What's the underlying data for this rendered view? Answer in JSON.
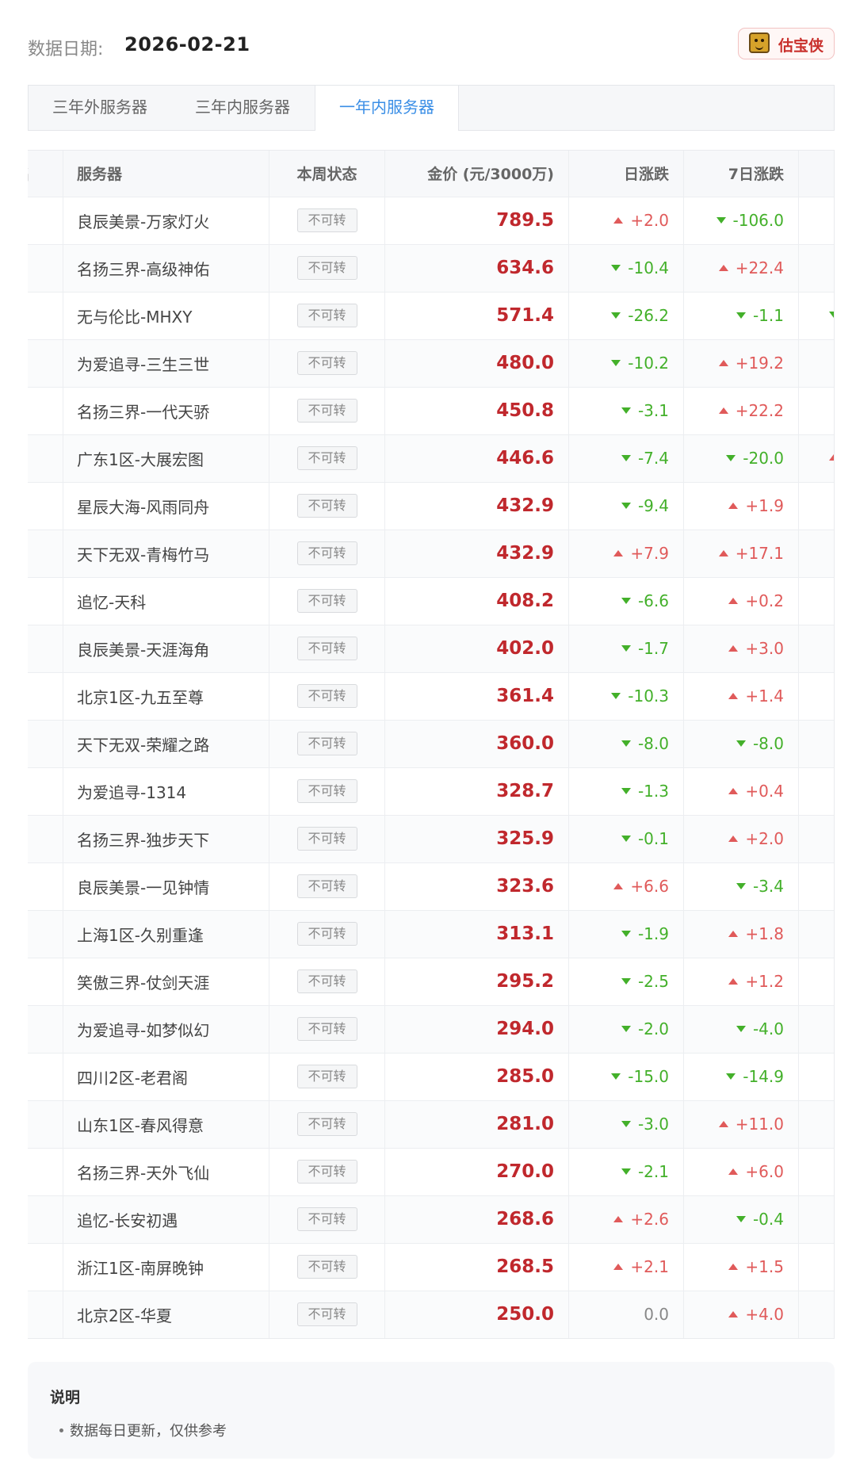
{
  "header": {
    "date_label": "数据日期:",
    "date_value": "2026-02-21",
    "brand_name": "估宝侠",
    "brand_logo_icon": "tiger-logo-icon"
  },
  "tabs": [
    {
      "label": "三年外服务器",
      "active": false
    },
    {
      "label": "三年内服务器",
      "active": false
    },
    {
      "label": "一年内服务器",
      "active": true
    }
  ],
  "colors": {
    "active_tab": "#3a8ee6",
    "price": "#c0282d",
    "up": "#e05a5a",
    "down": "#43b02a",
    "flat": "#888888"
  },
  "table": {
    "columns": {
      "rank": "名",
      "server": "服务器",
      "status": "本周状态",
      "price": "金价 (元/3000万)",
      "day": "日涨跌",
      "week": "7日涨跌"
    },
    "rows": [
      {
        "server": "良辰美景-万家灯火",
        "status": "不可转",
        "price": "789.5",
        "day": "+2.0",
        "day_dir": "up",
        "week": "-106.0",
        "week_dir": "down",
        "extra": ""
      },
      {
        "server": "名扬三界-高级神佑",
        "status": "不可转",
        "price": "634.6",
        "day": "-10.4",
        "day_dir": "down",
        "week": "+22.4",
        "week_dir": "up",
        "extra": ""
      },
      {
        "server": "无与伦比-MHXY",
        "status": "不可转",
        "price": "571.4",
        "day": "-26.2",
        "day_dir": "down",
        "week": "-1.1",
        "week_dir": "down",
        "extra": "down"
      },
      {
        "server": "为爱追寻-三生三世",
        "status": "不可转",
        "price": "480.0",
        "day": "-10.2",
        "day_dir": "down",
        "week": "+19.2",
        "week_dir": "up",
        "extra": ""
      },
      {
        "server": "名扬三界-一代天骄",
        "status": "不可转",
        "price": "450.8",
        "day": "-3.1",
        "day_dir": "down",
        "week": "+22.2",
        "week_dir": "up",
        "extra": ""
      },
      {
        "server": "广东1区-大展宏图",
        "status": "不可转",
        "price": "446.6",
        "day": "-7.4",
        "day_dir": "down",
        "week": "-20.0",
        "week_dir": "down",
        "extra": "up"
      },
      {
        "server": "星辰大海-风雨同舟",
        "status": "不可转",
        "price": "432.9",
        "day": "-9.4",
        "day_dir": "down",
        "week": "+1.9",
        "week_dir": "up",
        "extra": ""
      },
      {
        "server": "天下无双-青梅竹马",
        "status": "不可转",
        "price": "432.9",
        "day": "+7.9",
        "day_dir": "up",
        "week": "+17.1",
        "week_dir": "up",
        "extra": ""
      },
      {
        "server": "追忆-天科",
        "status": "不可转",
        "price": "408.2",
        "day": "-6.6",
        "day_dir": "down",
        "week": "+0.2",
        "week_dir": "up",
        "extra": ""
      },
      {
        "server": "良辰美景-天涯海角",
        "status": "不可转",
        "price": "402.0",
        "day": "-1.7",
        "day_dir": "down",
        "week": "+3.0",
        "week_dir": "up",
        "extra": ""
      },
      {
        "server": "北京1区-九五至尊",
        "status": "不可转",
        "price": "361.4",
        "day": "-10.3",
        "day_dir": "down",
        "week": "+1.4",
        "week_dir": "up",
        "extra": ""
      },
      {
        "server": "天下无双-荣耀之路",
        "status": "不可转",
        "price": "360.0",
        "day": "-8.0",
        "day_dir": "down",
        "week": "-8.0",
        "week_dir": "down",
        "extra": ""
      },
      {
        "server": "为爱追寻-1314",
        "status": "不可转",
        "price": "328.7",
        "day": "-1.3",
        "day_dir": "down",
        "week": "+0.4",
        "week_dir": "up",
        "extra": ""
      },
      {
        "server": "名扬三界-独步天下",
        "status": "不可转",
        "price": "325.9",
        "day": "-0.1",
        "day_dir": "down",
        "week": "+2.0",
        "week_dir": "up",
        "extra": ""
      },
      {
        "server": "良辰美景-一见钟情",
        "status": "不可转",
        "price": "323.6",
        "day": "+6.6",
        "day_dir": "up",
        "week": "-3.4",
        "week_dir": "down",
        "extra": ""
      },
      {
        "server": "上海1区-久别重逢",
        "status": "不可转",
        "price": "313.1",
        "day": "-1.9",
        "day_dir": "down",
        "week": "+1.8",
        "week_dir": "up",
        "extra": ""
      },
      {
        "server": "笑傲三界-仗剑天涯",
        "status": "不可转",
        "price": "295.2",
        "day": "-2.5",
        "day_dir": "down",
        "week": "+1.2",
        "week_dir": "up",
        "extra": ""
      },
      {
        "server": "为爱追寻-如梦似幻",
        "status": "不可转",
        "price": "294.0",
        "day": "-2.0",
        "day_dir": "down",
        "week": "-4.0",
        "week_dir": "down",
        "extra": ""
      },
      {
        "server": "四川2区-老君阁",
        "status": "不可转",
        "price": "285.0",
        "day": "-15.0",
        "day_dir": "down",
        "week": "-14.9",
        "week_dir": "down",
        "extra": ""
      },
      {
        "server": "山东1区-春风得意",
        "status": "不可转",
        "price": "281.0",
        "day": "-3.0",
        "day_dir": "down",
        "week": "+11.0",
        "week_dir": "up",
        "extra": ""
      },
      {
        "server": "名扬三界-天外飞仙",
        "status": "不可转",
        "price": "270.0",
        "day": "-2.1",
        "day_dir": "down",
        "week": "+6.0",
        "week_dir": "up",
        "extra": ""
      },
      {
        "server": "追忆-长安初遇",
        "status": "不可转",
        "price": "268.6",
        "day": "+2.6",
        "day_dir": "up",
        "week": "-0.4",
        "week_dir": "down",
        "extra": ""
      },
      {
        "server": "浙江1区-南屏晚钟",
        "status": "不可转",
        "price": "268.5",
        "day": "+2.1",
        "day_dir": "up",
        "week": "+1.5",
        "week_dir": "up",
        "extra": ""
      },
      {
        "server": "北京2区-华夏",
        "status": "不可转",
        "price": "250.0",
        "day": "0.0",
        "day_dir": "flat",
        "week": "+4.0",
        "week_dir": "up",
        "extra": ""
      }
    ]
  },
  "notes": {
    "title": "说明",
    "items": [
      "数据每日更新，仅供参考"
    ]
  }
}
